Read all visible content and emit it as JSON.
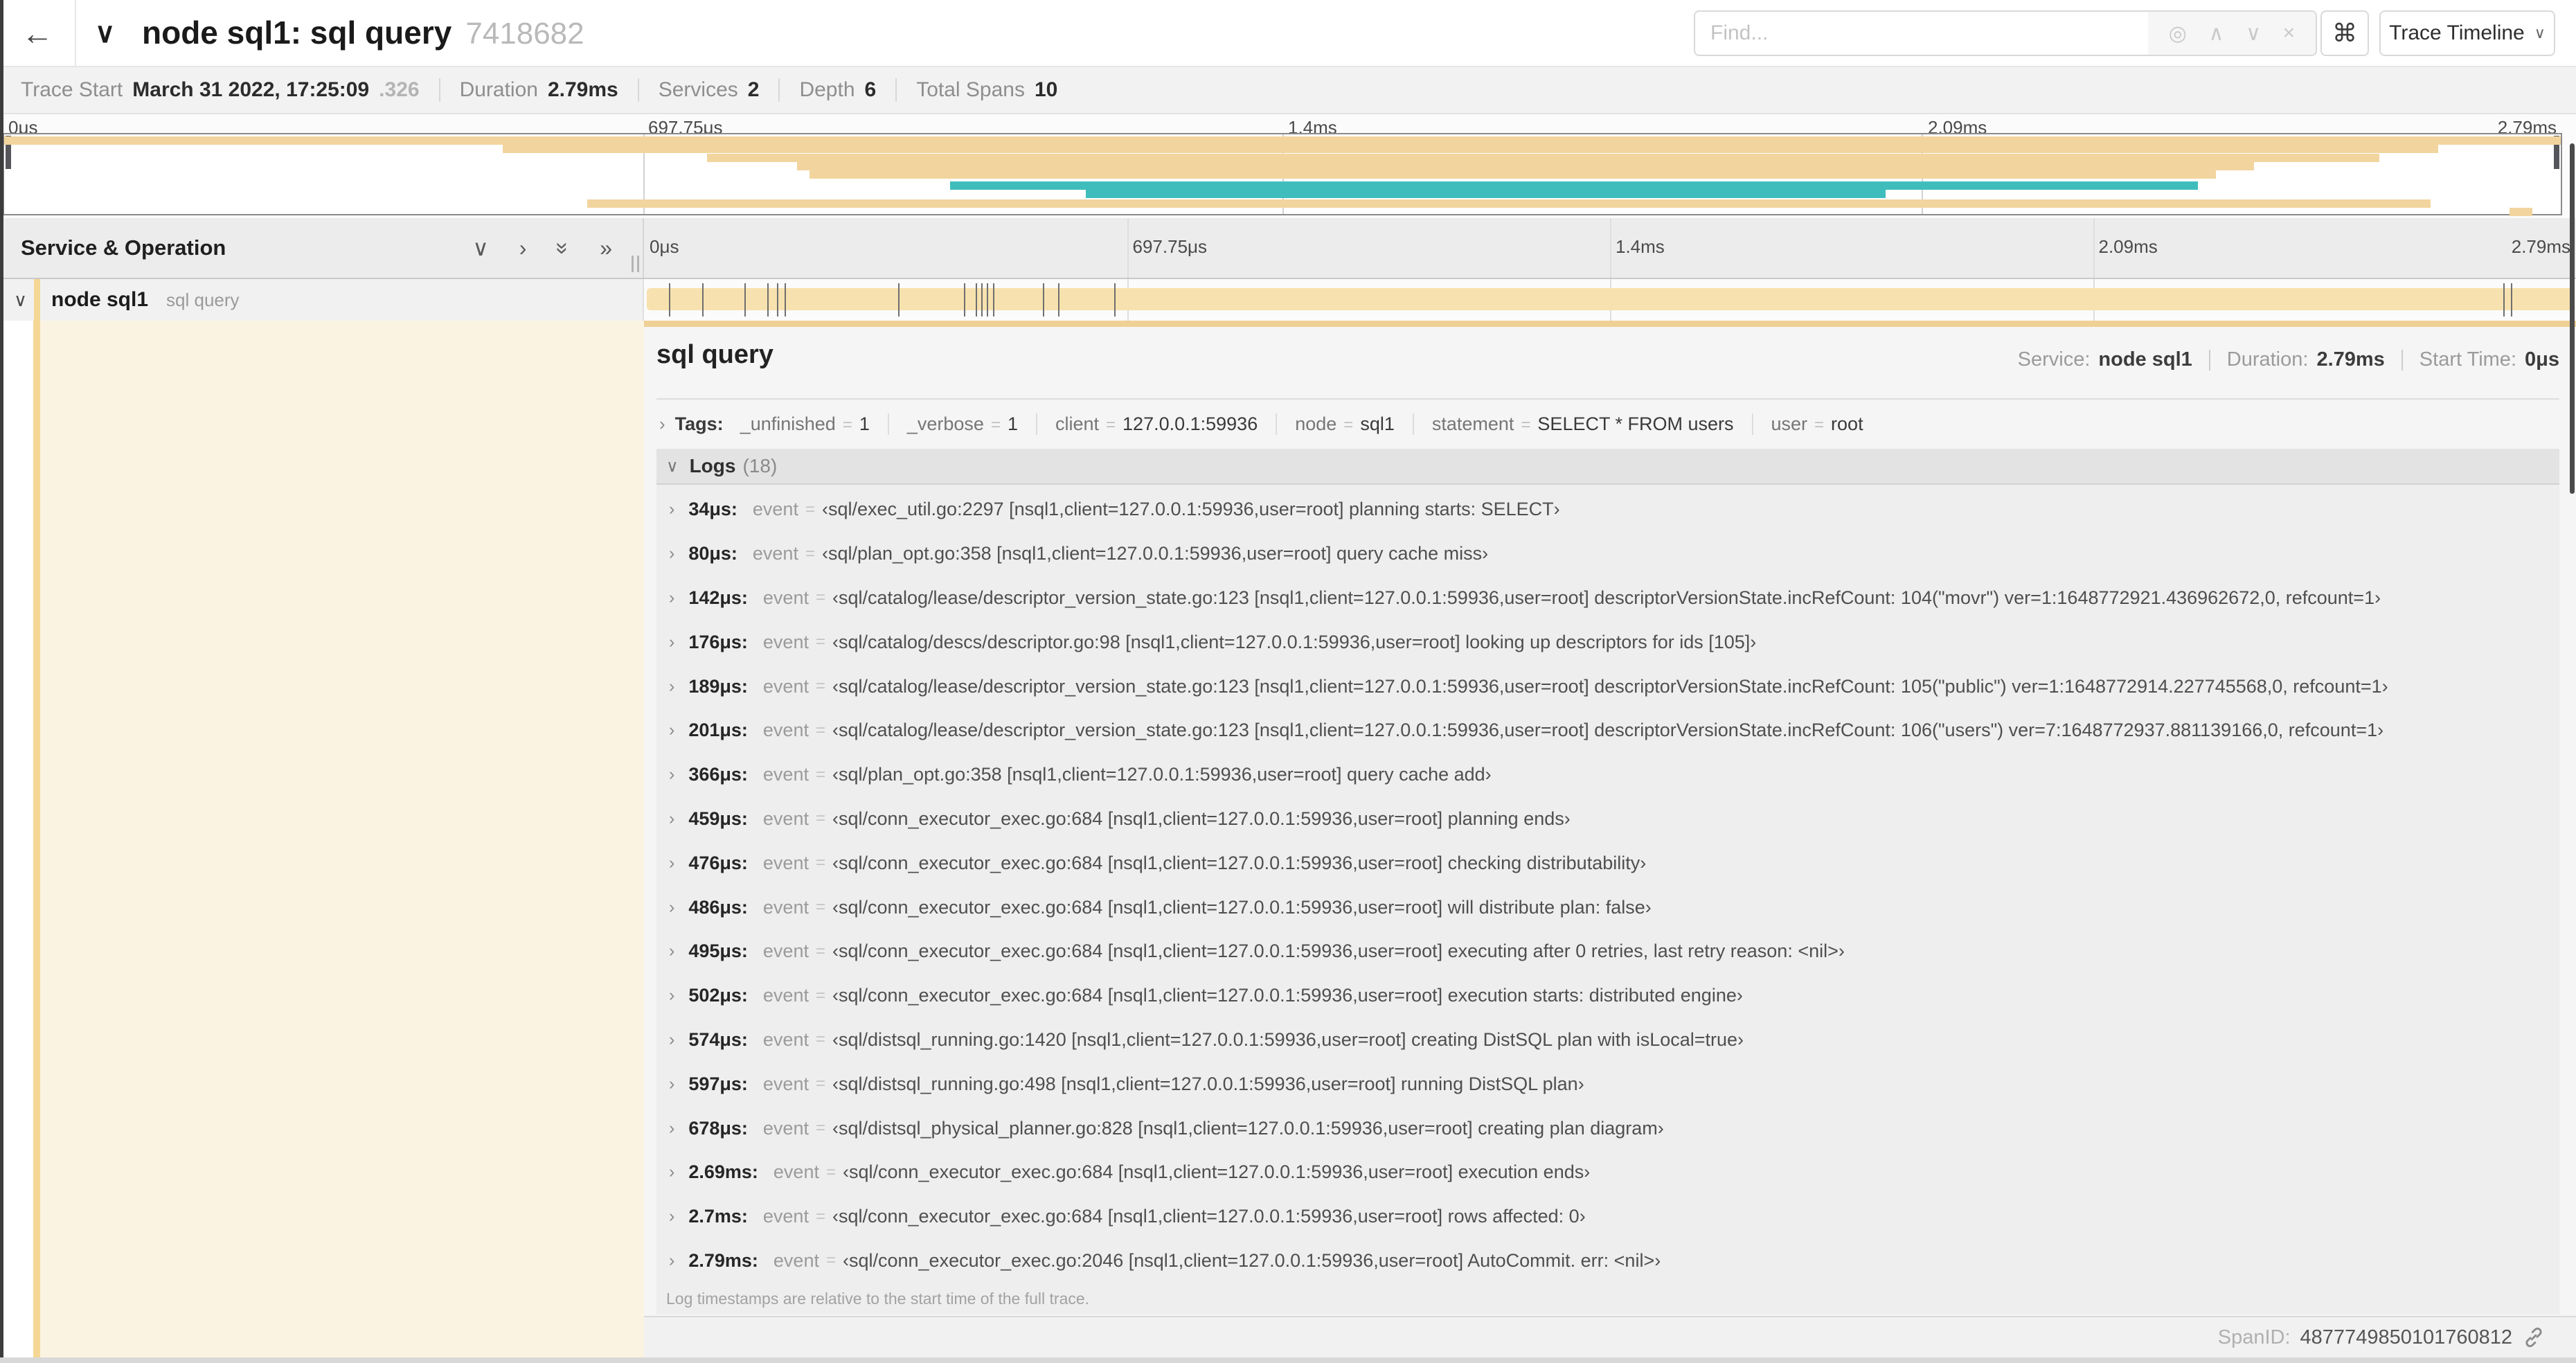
{
  "header": {
    "back_icon": "←",
    "title_collapse_icon": "∨",
    "title": "node sql1: sql query",
    "trace_id": "7418682",
    "find": {
      "placeholder": "Find...",
      "tools": [
        {
          "name": "locate-icon",
          "glyph": "◎"
        },
        {
          "name": "prev-match-icon",
          "glyph": "∧"
        },
        {
          "name": "next-match-icon",
          "glyph": "∨"
        },
        {
          "name": "clear-icon",
          "glyph": "×"
        }
      ]
    },
    "shortcuts_button": "⌘",
    "view_selector": {
      "label": "Trace Timeline",
      "caret": "∨"
    }
  },
  "trace_info": {
    "items": [
      {
        "label": "Trace Start",
        "value": "March 31 2022, 17:25:09",
        "suffix": ".326"
      },
      {
        "label": "Duration",
        "value": "2.79ms"
      },
      {
        "label": "Services",
        "value": "2"
      },
      {
        "label": "Depth",
        "value": "6"
      },
      {
        "label": "Total Spans",
        "value": "10"
      }
    ]
  },
  "minimap": {
    "ticks": [
      {
        "label": "0μs",
        "pct": 0
      },
      {
        "label": "697.75μs",
        "pct": 25
      },
      {
        "label": "1.4ms",
        "pct": 50
      },
      {
        "label": "2.09ms",
        "pct": 75
      },
      {
        "label": "2.79ms",
        "pct": 100
      }
    ],
    "bars": [
      {
        "row": 0,
        "start": 0,
        "end": 100,
        "color": "tan"
      },
      {
        "row": 1,
        "start": 19.5,
        "end": 95.2,
        "color": "tan"
      },
      {
        "row": 2,
        "start": 27.5,
        "end": 92.9,
        "color": "tan"
      },
      {
        "row": 3,
        "start": 31,
        "end": 88,
        "color": "tan"
      },
      {
        "row": 4,
        "start": 31.5,
        "end": 86.5,
        "color": "tan"
      },
      {
        "row": 5.3,
        "start": 37,
        "end": 85.8,
        "color": "teal"
      },
      {
        "row": 6.3,
        "start": 42.3,
        "end": 73.6,
        "color": "teal"
      },
      {
        "row": 7.4,
        "start": 22.8,
        "end": 94.9,
        "color": "tan"
      },
      {
        "row": 8.4,
        "start": 98,
        "end": 98.9,
        "color": "tan"
      }
    ]
  },
  "timeline": {
    "left_header": "Service & Operation",
    "collapse_icons": [
      {
        "name": "collapse-all-icon",
        "glyph": "∨"
      },
      {
        "name": "expand-one-icon",
        "glyph": "›"
      },
      {
        "name": "collapse-deep-icon",
        "glyph": "»",
        "rot": 90
      },
      {
        "name": "expand-all-icon",
        "glyph": "»"
      }
    ],
    "ticks": [
      {
        "label": "0μs",
        "pct": 0
      },
      {
        "label": "697.75μs",
        "pct": 25
      },
      {
        "label": "1.4ms",
        "pct": 50
      },
      {
        "label": "2.09ms",
        "pct": 75
      },
      {
        "label": "2.79ms",
        "pct": 100
      }
    ],
    "span_row": {
      "collapse_icon": "∨",
      "service": "node sql1",
      "operation": "sql query",
      "log_marker_pcts": [
        1.2,
        2.9,
        5.1,
        6.3,
        6.8,
        7.2,
        13.1,
        16.5,
        17.1,
        17.4,
        17.7,
        18,
        20.6,
        21.4,
        24.3,
        96.4,
        96.8,
        99.9
      ]
    }
  },
  "detail": {
    "title": "sql query",
    "meta": [
      {
        "label": "Service:",
        "value": "node sql1"
      },
      {
        "label": "Duration:",
        "value": "2.79ms"
      },
      {
        "label": "Start Time:",
        "value": "0μs"
      }
    ],
    "tags": {
      "expander_icon": "›",
      "label": "Tags:",
      "items": [
        {
          "key": "_unfinished",
          "value": "1"
        },
        {
          "key": "_verbose",
          "value": "1"
        },
        {
          "key": "client",
          "value": "127.0.0.1:59936"
        },
        {
          "key": "node",
          "value": "sql1"
        },
        {
          "key": "statement",
          "value": "SELECT * FROM users"
        },
        {
          "key": "user",
          "value": "root"
        }
      ]
    },
    "logs": {
      "expander_icon": "∨",
      "label": "Logs",
      "count": "(18)",
      "rows": [
        {
          "time": "34μs:",
          "key": "event",
          "value": "‹sql/exec_util.go:2297 [nsql1,client=127.0.0.1:59936,user=root] planning starts: SELECT›"
        },
        {
          "time": "80μs:",
          "key": "event",
          "value": "‹sql/plan_opt.go:358 [nsql1,client=127.0.0.1:59936,user=root] query cache miss›"
        },
        {
          "time": "142μs:",
          "key": "event",
          "value": "‹sql/catalog/lease/descriptor_version_state.go:123 [nsql1,client=127.0.0.1:59936,user=root] descriptorVersionState.incRefCount: 104(\"movr\") ver=1:1648772921.436962672,0, refcount=1›"
        },
        {
          "time": "176μs:",
          "key": "event",
          "value": "‹sql/catalog/descs/descriptor.go:98 [nsql1,client=127.0.0.1:59936,user=root] looking up descriptors for ids [105]›"
        },
        {
          "time": "189μs:",
          "key": "event",
          "value": "‹sql/catalog/lease/descriptor_version_state.go:123 [nsql1,client=127.0.0.1:59936,user=root] descriptorVersionState.incRefCount: 105(\"public\") ver=1:1648772914.227745568,0, refcount=1›"
        },
        {
          "time": "201μs:",
          "key": "event",
          "value": "‹sql/catalog/lease/descriptor_version_state.go:123 [nsql1,client=127.0.0.1:59936,user=root] descriptorVersionState.incRefCount: 106(\"users\") ver=7:1648772937.881139166,0, refcount=1›"
        },
        {
          "time": "366μs:",
          "key": "event",
          "value": "‹sql/plan_opt.go:358 [nsql1,client=127.0.0.1:59936,user=root] query cache add›"
        },
        {
          "time": "459μs:",
          "key": "event",
          "value": "‹sql/conn_executor_exec.go:684 [nsql1,client=127.0.0.1:59936,user=root] planning ends›"
        },
        {
          "time": "476μs:",
          "key": "event",
          "value": "‹sql/conn_executor_exec.go:684 [nsql1,client=127.0.0.1:59936,user=root] checking distributability›"
        },
        {
          "time": "486μs:",
          "key": "event",
          "value": "‹sql/conn_executor_exec.go:684 [nsql1,client=127.0.0.1:59936,user=root] will distribute plan: false›"
        },
        {
          "time": "495μs:",
          "key": "event",
          "value": "‹sql/conn_executor_exec.go:684 [nsql1,client=127.0.0.1:59936,user=root] executing after 0 retries, last retry reason: <nil>›"
        },
        {
          "time": "502μs:",
          "key": "event",
          "value": "‹sql/conn_executor_exec.go:684 [nsql1,client=127.0.0.1:59936,user=root] execution starts: distributed engine›"
        },
        {
          "time": "574μs:",
          "key": "event",
          "value": "‹sql/distsql_running.go:1420 [nsql1,client=127.0.0.1:59936,user=root] creating DistSQL plan with isLocal=true›"
        },
        {
          "time": "597μs:",
          "key": "event",
          "value": "‹sql/distsql_running.go:498 [nsql1,client=127.0.0.1:59936,user=root] running DistSQL plan›"
        },
        {
          "time": "678μs:",
          "key": "event",
          "value": "‹sql/distsql_physical_planner.go:828 [nsql1,client=127.0.0.1:59936,user=root] creating plan diagram›"
        },
        {
          "time": "2.69ms:",
          "key": "event",
          "value": "‹sql/conn_executor_exec.go:684 [nsql1,client=127.0.0.1:59936,user=root] execution ends›"
        },
        {
          "time": "2.7ms:",
          "key": "event",
          "value": "‹sql/conn_executor_exec.go:684 [nsql1,client=127.0.0.1:59936,user=root] rows affected: 0›"
        },
        {
          "time": "2.79ms:",
          "key": "event",
          "value": "‹sql/conn_executor_exec.go:2046 [nsql1,client=127.0.0.1:59936,user=root] AutoCommit. err: <nil>›"
        }
      ],
      "note": "Log timestamps are relative to the start time of the full trace."
    },
    "footer": {
      "label": "SpanID:",
      "value": "4877749850101760812"
    }
  },
  "colors": {
    "tan": "#f2d59e",
    "teal": "#3fbdbd",
    "accent": "#efd096",
    "cream": "#fbf3e1",
    "span_bar": "#f7e1ae",
    "color_bar": "#f5d795"
  }
}
